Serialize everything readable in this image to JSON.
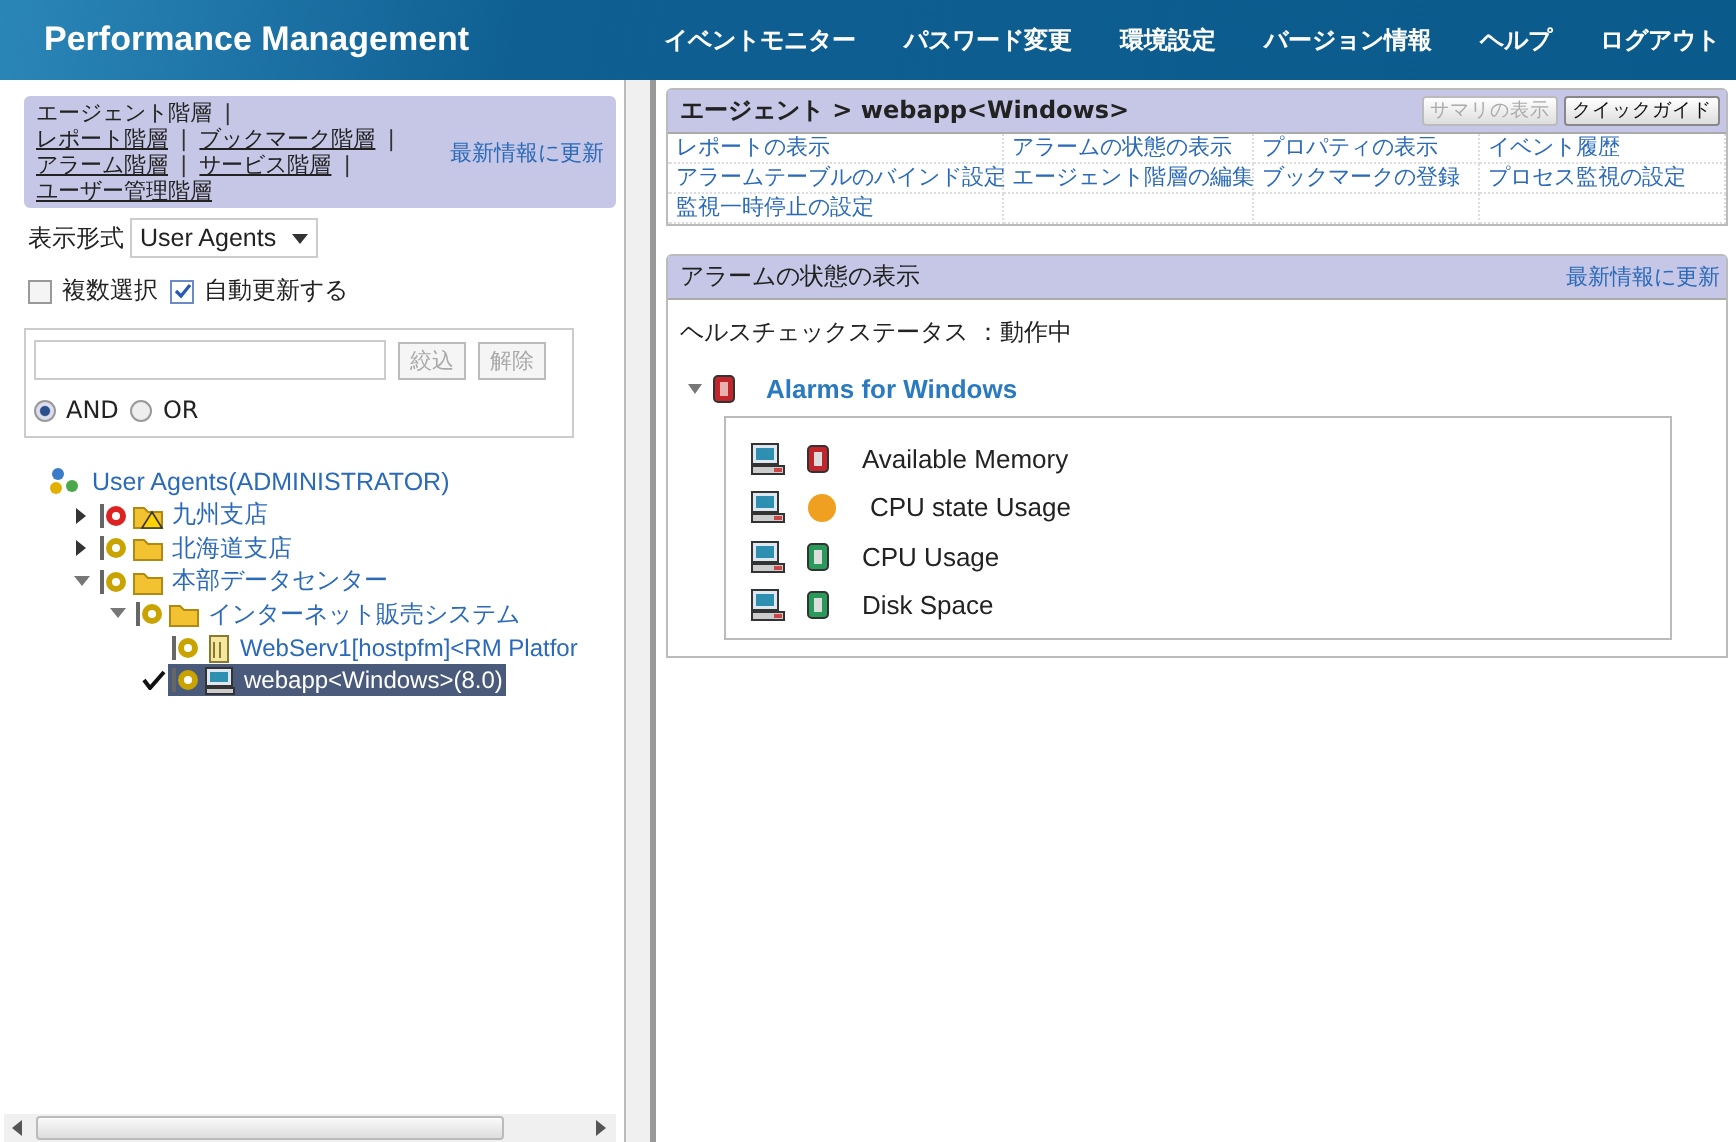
{
  "header": {
    "title": "Performance Management",
    "menu": [
      "イベントモニター",
      "パスワード変更",
      "環境設定",
      "バージョン情報",
      "ヘルプ",
      "ログアウト"
    ]
  },
  "hierarchy": {
    "rows": [
      {
        "items": [
          {
            "label": "エージェント階層",
            "selected": true,
            "separator": "|"
          }
        ]
      },
      {
        "items": [
          {
            "label": "レポート階層",
            "selected": false,
            "separator": "|"
          },
          {
            "label": "ブックマーク階層",
            "selected": false,
            "separator": "|"
          }
        ]
      },
      {
        "items": [
          {
            "label": "アラーム階層",
            "selected": false,
            "separator": "|"
          },
          {
            "label": "サービス階層",
            "selected": false,
            "separator": "|"
          }
        ]
      },
      {
        "items": [
          {
            "label": "ユーザー管理階層",
            "selected": false
          }
        ]
      }
    ],
    "refresh": "最新情報に更新"
  },
  "display": {
    "label": "表示形式",
    "value": "User Agents"
  },
  "options": [
    {
      "label": "複数選択",
      "checked": false
    },
    {
      "label": "自動更新する",
      "checked": true
    }
  ],
  "filter": {
    "buttons": [
      {
        "label": "絞込",
        "disabled": true
      },
      {
        "label": "解除",
        "disabled": true
      }
    ],
    "modes": [
      {
        "label": "AND",
        "selected": true
      },
      {
        "label": "OR",
        "selected": false
      }
    ]
  },
  "tree": {
    "root": "User Agents(ADMINISTRATOR)",
    "children": [
      {
        "label": "九州支店",
        "kind": "folder",
        "color": "#dd2222",
        "warning": true,
        "expanded": false,
        "selected": false
      },
      {
        "label": "北海道支店",
        "kind": "folder",
        "color": "#c9a400",
        "warning": false,
        "expanded": false,
        "selected": false
      },
      {
        "label": "本部データセンター",
        "kind": "folder",
        "color": "#c9a400",
        "warning": false,
        "expanded": true,
        "selected": false,
        "children": [
          {
            "label": "インターネット販売システム",
            "kind": "folder",
            "color": "#c9a400",
            "warning": false,
            "expanded": true,
            "selected": false,
            "children": [
              {
                "label": "WebServ1[hostpfm]<RM Platfor",
                "kind": "server",
                "color": "#c9a400",
                "selected": false
              },
              {
                "label": "webapp<Windows>(8.0)",
                "kind": "pc",
                "color": "#c9a400",
                "selected": true
              }
            ]
          }
        ]
      }
    ]
  },
  "agent_panel": {
    "title": "エージェント > webapp<Windows>",
    "buttons": [
      {
        "label": "サマリの表示",
        "disabled": true
      },
      {
        "label": "クイックガイド",
        "disabled": false
      }
    ],
    "links": [
      "レポートの表示",
      "アラームの状態の表示",
      "プロパティの表示",
      "イベント履歴",
      "アラームテーブルのバインド設定",
      "エージェント階層の編集",
      "ブックマークの登録",
      "プロセス監視の設定",
      "監視一時停止の設定"
    ]
  },
  "alarm_panel": {
    "title": "アラームの状態の表示",
    "refresh": "最新情報に更新",
    "health": "ヘルスチェックステータス ：動作中",
    "table": {
      "name": "Alarms for Windows",
      "color": "#c0262b",
      "expanded": true,
      "alarms": [
        {
          "name": "Available Memory",
          "kind": "cylinder",
          "color": "#c0262b"
        },
        {
          "name": "CPU state Usage",
          "kind": "circle",
          "color": "#f0a020"
        },
        {
          "name": "CPU Usage",
          "kind": "cylinder",
          "color": "#2a9a5a"
        },
        {
          "name": "Disk Space",
          "kind": "cylinder",
          "color": "#2a9a5a"
        }
      ]
    }
  }
}
